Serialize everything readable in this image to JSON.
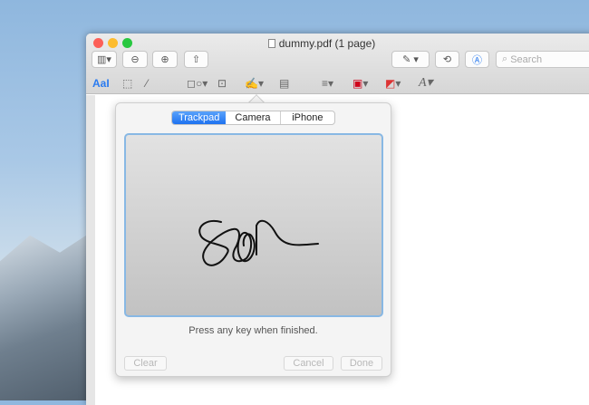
{
  "window": {
    "title": "dummy.pdf (1 page)"
  },
  "toolbar": {
    "search_placeholder": "Search"
  },
  "markup_toolbar": {
    "text_style": "AaI"
  },
  "signature_popover": {
    "tabs": [
      {
        "label": "Trackpad",
        "selected": true
      },
      {
        "label": "Camera",
        "selected": false
      },
      {
        "label": "iPhone",
        "selected": false
      }
    ],
    "hint": "Press any key when finished.",
    "clear_label": "Clear",
    "cancel_label": "Cancel",
    "done_label": "Done"
  },
  "colors": {
    "accent": "#1e72f0",
    "canvas_border": "#88b8e4",
    "border_color_swatch": "#d0021b"
  }
}
